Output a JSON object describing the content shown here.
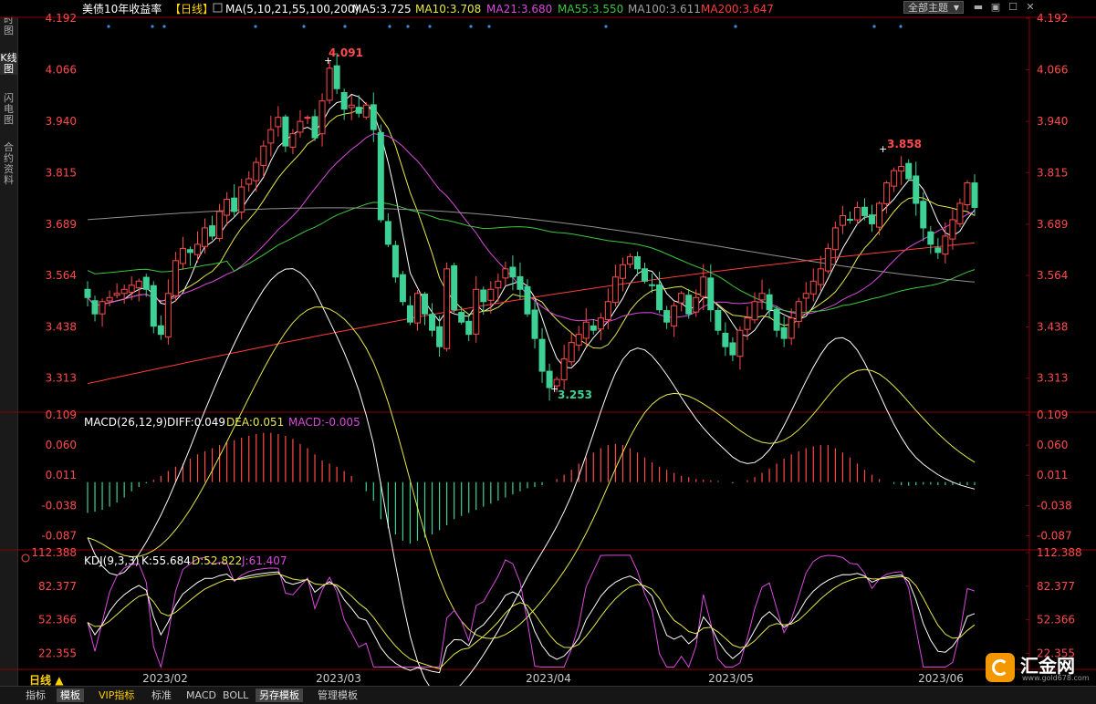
{
  "sidebar": {
    "tabs": [
      {
        "label": "分时图"
      },
      {
        "label": "K线图"
      },
      {
        "label": "闪电图"
      },
      {
        "label": "合约资料"
      }
    ]
  },
  "header": {
    "theme_button": "全部主题",
    "price_title": "美债10年收益率",
    "period_tag": "【日线】",
    "ma_name": "MA(5,10,21,55,100,200)",
    "ma5": "MA5:3.725",
    "ma10": "MA10:3.708",
    "ma21": "MA21:3.680",
    "ma55": "MA55:3.550",
    "ma100": "MA100:3.611",
    "ma200": "MA200:3.647"
  },
  "macd": {
    "name": "MACD(26,12,9)",
    "diff": "DIFF:0.049",
    "dea": "DEA:0.051",
    "macd": "MACD:-0.005"
  },
  "kdj": {
    "name": "KDJ(9,3,3)",
    "k": "K:55.684",
    "d": "D:52.822",
    "j": "J:61.407"
  },
  "period_button": "日线",
  "bottom_tabs": [
    "指标",
    "模板",
    "VIP指标",
    "标准",
    "MACD",
    "BOLL",
    "另存模板",
    "管理模板"
  ],
  "logo": {
    "name": "汇金网",
    "url": "www.gold678.com"
  },
  "colors": {
    "up": "#ff4b4b",
    "down": "#3ed196",
    "ma5": "#ffffff",
    "ma10": "#e8e84a",
    "ma21": "#d94adb",
    "ma55": "#3cc83c",
    "ma100": "#909090",
    "ma200": "#ff3b3b"
  },
  "chart_data": {
    "type": "candlestick",
    "x_labels": [
      "2023/02",
      "2023/03",
      "2023/04",
      "2023/05",
      "2023/06"
    ],
    "price_axis": {
      "ticks": [
        "4.192",
        "4.066",
        "3.940",
        "3.815",
        "3.689",
        "3.564",
        "3.438",
        "3.313"
      ],
      "range": [
        3.23,
        4.192
      ]
    },
    "macd_axis": {
      "ticks": [
        "0.109",
        "0.060",
        "0.011",
        "-0.038",
        "-0.087"
      ],
      "range": [
        -0.11,
        0.109
      ]
    },
    "kdj_axis": {
      "ticks": [
        "112.388",
        "82.377",
        "52.366",
        "22.355"
      ],
      "range": [
        8,
        112.388
      ]
    },
    "annotations": {
      "high": "4.091",
      "low": "3.253",
      "recent_high": "3.858"
    },
    "closes": [
      3.51,
      3.47,
      3.5,
      3.51,
      3.52,
      3.53,
      3.54,
      3.55,
      3.53,
      3.44,
      3.42,
      3.52,
      3.6,
      3.63,
      3.62,
      3.64,
      3.68,
      3.66,
      3.72,
      3.75,
      3.72,
      3.78,
      3.8,
      3.84,
      3.88,
      3.92,
      3.95,
      3.88,
      3.91,
      3.94,
      3.95,
      3.9,
      3.99,
      4.07,
      4.02,
      3.97,
      3.98,
      3.96,
      3.98,
      3.92,
      3.7,
      3.64,
      3.56,
      3.5,
      3.45,
      3.52,
      3.47,
      3.43,
      3.39,
      3.58,
      3.48,
      3.45,
      3.42,
      3.53,
      3.5,
      3.53,
      3.55,
      3.58,
      3.56,
      3.53,
      3.47,
      3.41,
      3.33,
      3.29,
      3.31,
      3.36,
      3.4,
      3.42,
      3.45,
      3.43,
      3.46,
      3.5,
      3.56,
      3.59,
      3.61,
      3.58,
      3.55,
      3.54,
      3.48,
      3.45,
      3.49,
      3.52,
      3.47,
      3.51,
      3.56,
      3.48,
      3.43,
      3.39,
      3.37,
      3.43,
      3.46,
      3.5,
      3.52,
      3.48,
      3.43,
      3.41,
      3.46,
      3.5,
      3.52,
      3.55,
      3.58,
      3.63,
      3.68,
      3.71,
      3.7,
      3.73,
      3.71,
      3.69,
      3.74,
      3.79,
      3.82,
      3.83,
      3.8,
      3.74,
      3.68,
      3.64,
      3.62,
      3.66,
      3.7,
      3.74,
      3.79,
      3.73
    ],
    "macd_hist": [
      -0.05,
      -0.048,
      -0.045,
      -0.04,
      -0.033,
      -0.025,
      -0.015,
      -0.008,
      -0.002,
      0.004,
      0.01,
      0.018,
      0.025,
      0.03,
      0.038,
      0.045,
      0.05,
      0.055,
      0.06,
      0.064,
      0.068,
      0.072,
      0.075,
      0.078,
      0.08,
      0.08,
      0.078,
      0.075,
      0.07,
      0.062,
      0.055,
      0.045,
      0.035,
      0.03,
      0.025,
      0.018,
      0.01,
      0.0,
      -0.015,
      -0.03,
      -0.06,
      -0.075,
      -0.085,
      -0.095,
      -0.1,
      -0.095,
      -0.09,
      -0.085,
      -0.078,
      -0.07,
      -0.06,
      -0.055,
      -0.05,
      -0.045,
      -0.04,
      -0.035,
      -0.03,
      -0.025,
      -0.02,
      -0.015,
      -0.01,
      -0.008,
      -0.005,
      0.0,
      0.005,
      0.012,
      0.02,
      0.03,
      0.04,
      0.048,
      0.055,
      0.06,
      0.062,
      0.06,
      0.055,
      0.048,
      0.04,
      0.032,
      0.025,
      0.02,
      0.015,
      0.01,
      0.008,
      0.005,
      0.004,
      0.003,
      0.002,
      0.0,
      -0.002,
      0.0,
      0.003,
      0.008,
      0.015,
      0.022,
      0.03,
      0.038,
      0.045,
      0.05,
      0.055,
      0.058,
      0.06,
      0.06,
      0.055,
      0.048,
      0.04,
      0.03,
      0.02,
      0.012,
      0.005,
      0.0,
      -0.003,
      -0.005,
      -0.006,
      -0.005,
      -0.004,
      -0.004,
      -0.005,
      -0.005,
      -0.005,
      -0.005,
      -0.005,
      -0.005
    ]
  }
}
